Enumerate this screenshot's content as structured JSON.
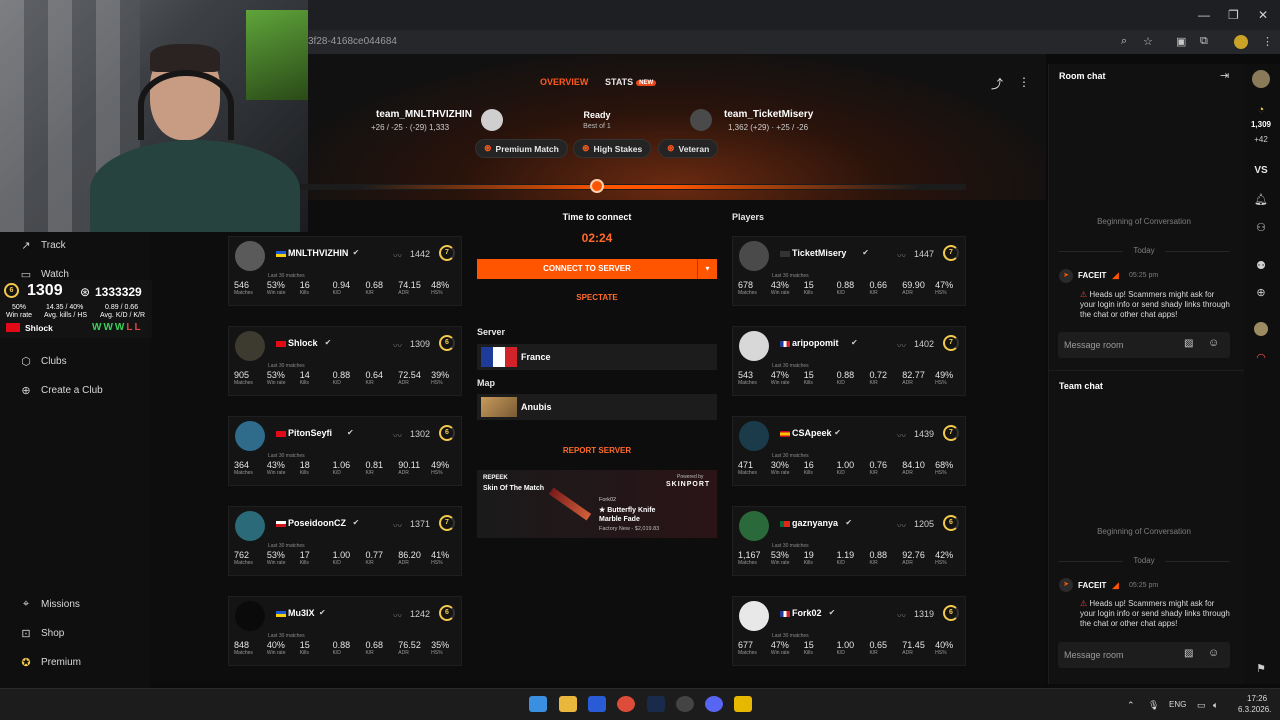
{
  "browser": {
    "url": "3f28-4168ce044684",
    "window_controls": [
      "—",
      "❐",
      "✕"
    ]
  },
  "sidebar": {
    "items": [
      {
        "label": "Track",
        "icon": "chart-icon"
      },
      {
        "label": "Watch",
        "icon": "tv-icon"
      },
      {
        "label": "Clubs",
        "icon": "clubs-icon"
      },
      {
        "label": "Create a Club",
        "icon": "plus-circle-icon"
      },
      {
        "label": "Missions",
        "icon": "crosshair-icon"
      },
      {
        "label": "Shop",
        "icon": "cart-icon"
      },
      {
        "label": "Premium",
        "icon": "star-icon"
      }
    ]
  },
  "elo_overlay": {
    "level": "6",
    "elo": "1309",
    "points": "1333329",
    "row1": [
      "50%",
      "14.35 / 40%",
      "0.89 / 0.66"
    ],
    "row2": [
      "Win rate",
      "Avg. kills / HS",
      "Avg. K/D / K/R"
    ],
    "name": "Shlock",
    "results": [
      "W",
      "W",
      "W",
      "L",
      "L"
    ]
  },
  "tabs": {
    "overview": "OVERVIEW",
    "stats": "STATS",
    "stats_badge": "NEW"
  },
  "team1": {
    "name": "team_MNLTHVIZHIN",
    "sub": "+26 / -25 · (-29) 1,333"
  },
  "team2": {
    "name": "team_TicketMisery",
    "sub": "1,362 (+29) · +25 / -26"
  },
  "match_status": {
    "state": "Ready",
    "format": "Best of 1"
  },
  "chips": [
    "Premium Match",
    "High Stakes",
    "Veteran"
  ],
  "connect": {
    "time_label": "Time to connect",
    "timer": "02:24",
    "button": "CONNECT TO SERVER",
    "spectate": "SPECTATE",
    "server_label": "Server",
    "server": "France",
    "map_label": "Map",
    "map": "Anubis",
    "report": "REPORT SERVER"
  },
  "ad": {
    "brand": "REPEEK",
    "title": "Skin Of The Match",
    "powered": "Powered by",
    "sponsor": "SKINPORT",
    "owner": "Fork02",
    "item": "★ Butterfly Knife",
    "item2": "Marble Fade",
    "price": "Factory New - $2,019.83"
  },
  "players_label": "Players",
  "stat_labels": [
    "Matches",
    "Win rate",
    "Kills",
    "K/D",
    "K/R",
    "ADR",
    "HS%"
  ],
  "last30": "Last 30 matches",
  "team1_players": [
    {
      "name": "MNLTHVIZHIN",
      "elo": "1442",
      "level": "7",
      "flag": "ua",
      "stats": [
        "546",
        "53%",
        "16",
        "0.94",
        "0.68",
        "74.15",
        "48%"
      ]
    },
    {
      "name": "Shlock",
      "elo": "1309",
      "level": "6",
      "flag": "tr",
      "stats": [
        "905",
        "53%",
        "14",
        "0.88",
        "0.64",
        "72.54",
        "39%"
      ]
    },
    {
      "name": "PitonSeyfi",
      "elo": "1302",
      "level": "6",
      "flag": "tr",
      "stats": [
        "364",
        "43%",
        "18",
        "1.06",
        "0.81",
        "90.11",
        "49%"
      ]
    },
    {
      "name": "PoseidoonCZ",
      "elo": "1371",
      "level": "7",
      "flag": "cz",
      "stats": [
        "762",
        "53%",
        "17",
        "1.00",
        "0.77",
        "86.20",
        "41%"
      ]
    },
    {
      "name": "Mu3IX",
      "elo": "1242",
      "level": "6",
      "flag": "ua",
      "stats": [
        "848",
        "40%",
        "15",
        "0.88",
        "0.68",
        "76.52",
        "35%"
      ]
    }
  ],
  "team2_players": [
    {
      "name": "TicketMisery",
      "elo": "1447",
      "level": "7",
      "flag": "gb",
      "stats": [
        "678",
        "43%",
        "15",
        "0.88",
        "0.66",
        "69.90",
        "47%"
      ]
    },
    {
      "name": "aripopomit",
      "elo": "1402",
      "level": "7",
      "flag": "fr",
      "stats": [
        "543",
        "47%",
        "15",
        "0.88",
        "0.72",
        "82.77",
        "49%"
      ]
    },
    {
      "name": "CSApeek",
      "elo": "1439",
      "level": "7",
      "flag": "es",
      "stats": [
        "471",
        "30%",
        "16",
        "1.00",
        "0.76",
        "84.10",
        "68%"
      ]
    },
    {
      "name": "gaznyanya",
      "elo": "1205",
      "level": "6",
      "flag": "pt",
      "stats": [
        "1,167",
        "53%",
        "19",
        "1.19",
        "0.88",
        "92.76",
        "42%"
      ]
    },
    {
      "name": "Fork02",
      "elo": "1319",
      "level": "6",
      "flag": "fr",
      "stats": [
        "677",
        "47%",
        "15",
        "1.00",
        "0.65",
        "71.45",
        "40%"
      ]
    }
  ],
  "room_chat": {
    "title": "Room chat",
    "beginning": "Beginning of Conversation",
    "today": "Today",
    "sender": "FACEIT",
    "time": "05:25 pm",
    "message": "Heads up! Scammers might ask for your login info or send shady links through the chat or other chat apps!",
    "placeholder": "Message room"
  },
  "team_chat": {
    "title": "Team chat",
    "beginning": "Beginning of Conversation",
    "today": "Today",
    "sender": "FACEIT",
    "time": "05:25 pm",
    "message": "Heads up! Scammers might ask for your login info or send shady links through the chat or other chat apps!",
    "placeholder": "Message room"
  },
  "iconbar": {
    "elo": "1,309",
    "delta": "+42",
    "vs": "VS"
  },
  "taskbar": {
    "lang": "ENG",
    "time": "17:26",
    "date": "6.3.2026."
  },
  "colors": {
    "accent": "#ff5500",
    "level": "#f2c94c",
    "background": "#0d0d0d"
  }
}
